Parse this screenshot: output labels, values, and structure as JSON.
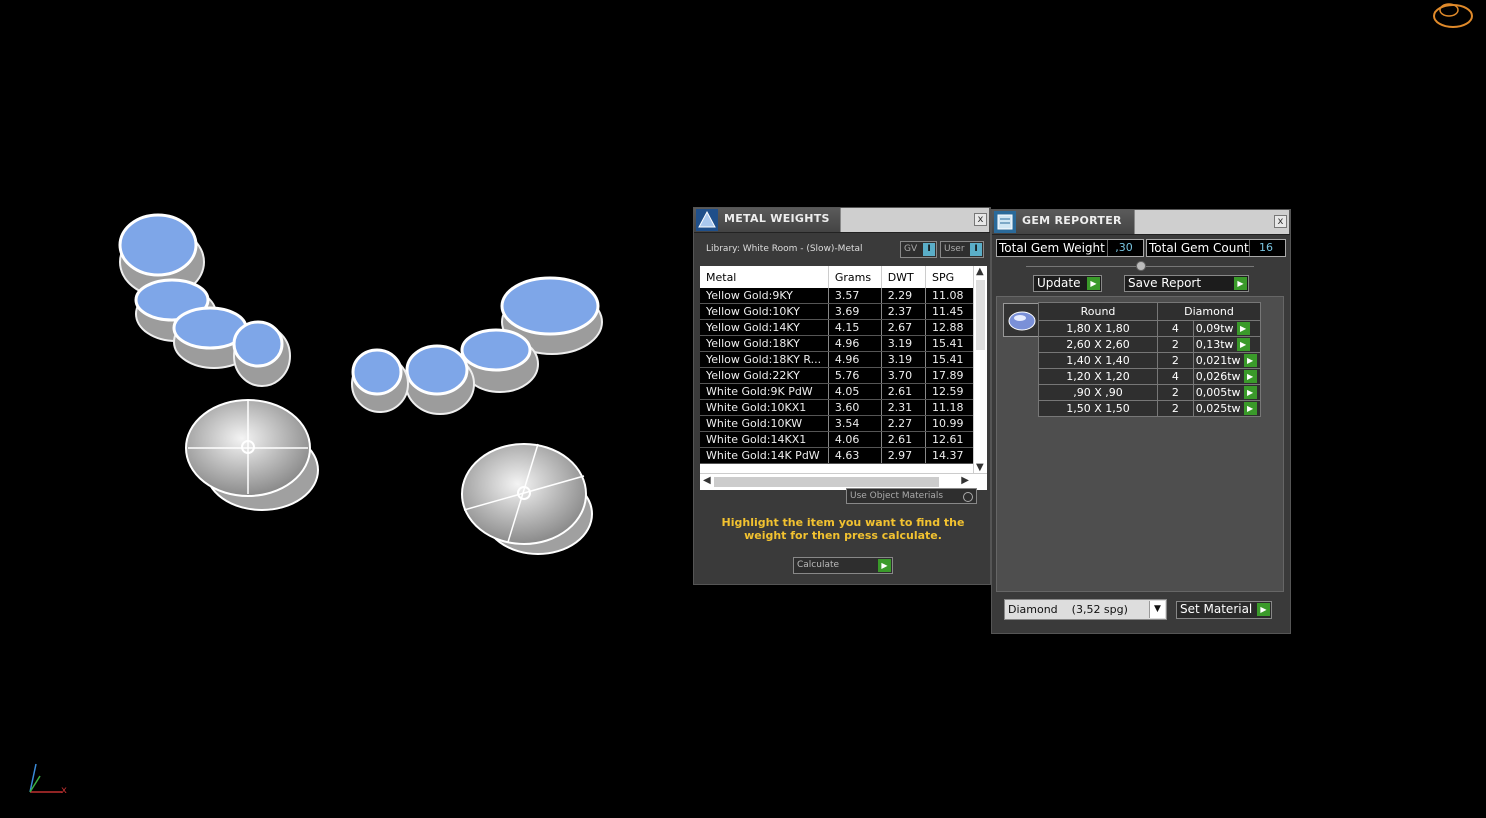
{
  "metal_weights": {
    "title": "METAL WEIGHTS",
    "close": "x",
    "library_label": "Library: White Room - (Slow)-Metal",
    "toggle_gv": "GV",
    "toggle_user": "User",
    "toggle_value": "I",
    "columns": [
      "Metal",
      "Grams",
      "DWT",
      "SPG"
    ],
    "rows": [
      [
        "Yellow Gold:9KY",
        "3.57",
        "2.29",
        "11.08"
      ],
      [
        "Yellow Gold:10KY",
        "3.69",
        "2.37",
        "11.45"
      ],
      [
        "Yellow Gold:14KY",
        "4.15",
        "2.67",
        "12.88"
      ],
      [
        "Yellow Gold:18KY",
        "4.96",
        "3.19",
        "15.41"
      ],
      [
        "Yellow Gold:18KY R...",
        "4.96",
        "3.19",
        "15.41"
      ],
      [
        "Yellow Gold:22KY",
        "5.76",
        "3.70",
        "17.89"
      ],
      [
        "White Gold:9K PdW",
        "4.05",
        "2.61",
        "12.59"
      ],
      [
        "White Gold:10KX1",
        "3.60",
        "2.31",
        "11.18"
      ],
      [
        "White Gold:10KW",
        "3.54",
        "2.27",
        "10.99"
      ],
      [
        "White Gold:14KX1",
        "4.06",
        "2.61",
        "12.61"
      ],
      [
        "White Gold:14K PdW",
        "4.63",
        "2.97",
        "14.37"
      ]
    ],
    "use_object_materials": "Use Object Materials",
    "hint": "Highlight the item you want to find the weight for then press calculate.",
    "calculate": "Calculate"
  },
  "gem_reporter": {
    "title": "GEM REPORTER",
    "close": "x",
    "total_weight_label": "Total Gem Weight",
    "total_weight_value": ",30",
    "total_count_label": "Total Gem Count",
    "total_count_value": "16",
    "update": "Update",
    "save_report": "Save Report",
    "headers": [
      "Round",
      "Diamond"
    ],
    "rows": [
      [
        "1,80 X 1,80",
        "4",
        "0,09tw"
      ],
      [
        "2,60 X 2,60",
        "2",
        "0,13tw"
      ],
      [
        "1,40 X 1,40",
        "2",
        "0,021tw"
      ],
      [
        "1,20 X 1,20",
        "4",
        "0,026tw"
      ],
      [
        ",90 X ,90",
        "2",
        "0,005tw"
      ],
      [
        "1,50 X 1,50",
        "2",
        "0,025tw"
      ]
    ],
    "material": "Diamond    (3,52 spg)",
    "set_material": "Set Material"
  },
  "axis": {
    "x": "x",
    "z": "z"
  },
  "colors": {
    "gem_blue": "#7ea6e8",
    "hint_yellow": "#f2c230",
    "go_green": "#3a9a2a"
  }
}
